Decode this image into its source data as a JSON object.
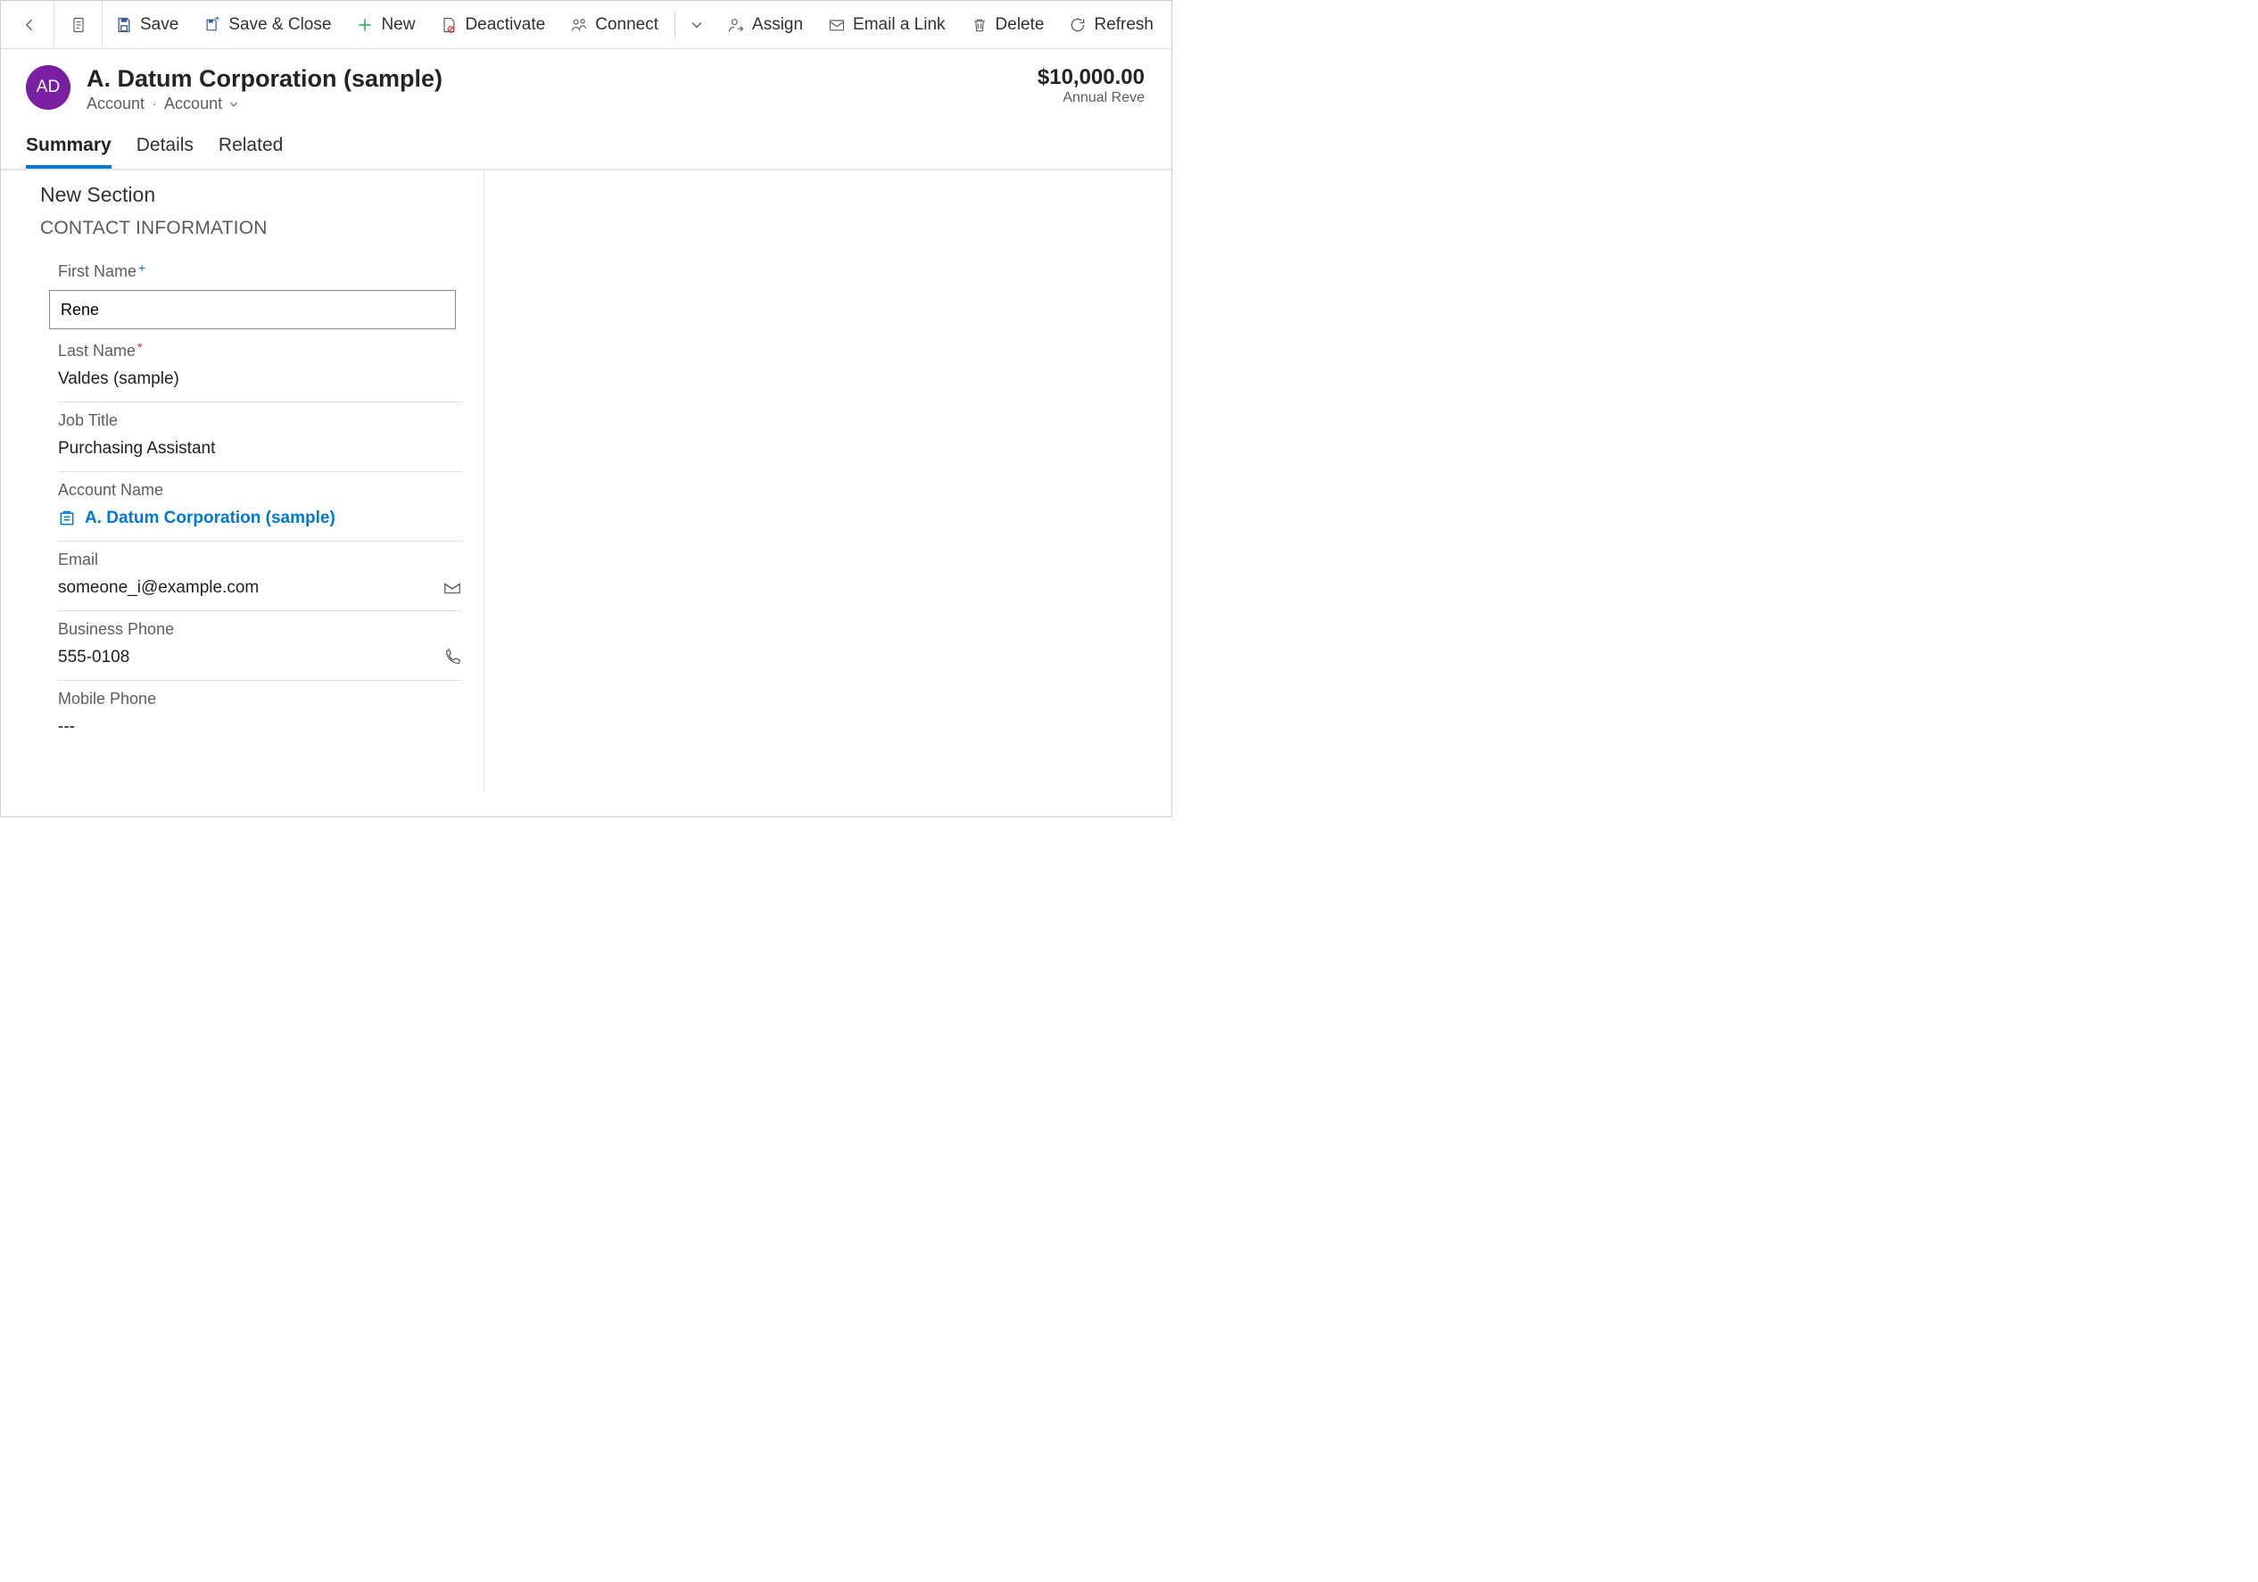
{
  "commandBar": {
    "save": "Save",
    "saveClose": "Save & Close",
    "new": "New",
    "deactivate": "Deactivate",
    "connect": "Connect",
    "assign": "Assign",
    "emailLink": "Email a Link",
    "delete": "Delete",
    "refresh": "Refresh"
  },
  "header": {
    "avatar": "AD",
    "title": "A. Datum Corporation (sample)",
    "entity": "Account",
    "form": "Account",
    "amount": "$10,000.00",
    "amountLabel": "Annual Reve"
  },
  "tabs": {
    "summary": "Summary",
    "details": "Details",
    "related": "Related"
  },
  "form": {
    "sectionTitle": "New Section",
    "sectionSub": "CONTACT INFORMATION",
    "firstName": {
      "label": "First Name",
      "value": "Rene"
    },
    "lastName": {
      "label": "Last Name",
      "value": "Valdes (sample)"
    },
    "jobTitle": {
      "label": "Job Title",
      "value": "Purchasing Assistant"
    },
    "accountName": {
      "label": "Account Name",
      "value": "A. Datum Corporation (sample)"
    },
    "email": {
      "label": "Email",
      "value": "someone_i@example.com"
    },
    "businessPhone": {
      "label": "Business Phone",
      "value": "555-0108"
    },
    "mobilePhone": {
      "label": "Mobile Phone",
      "value": "---"
    }
  }
}
